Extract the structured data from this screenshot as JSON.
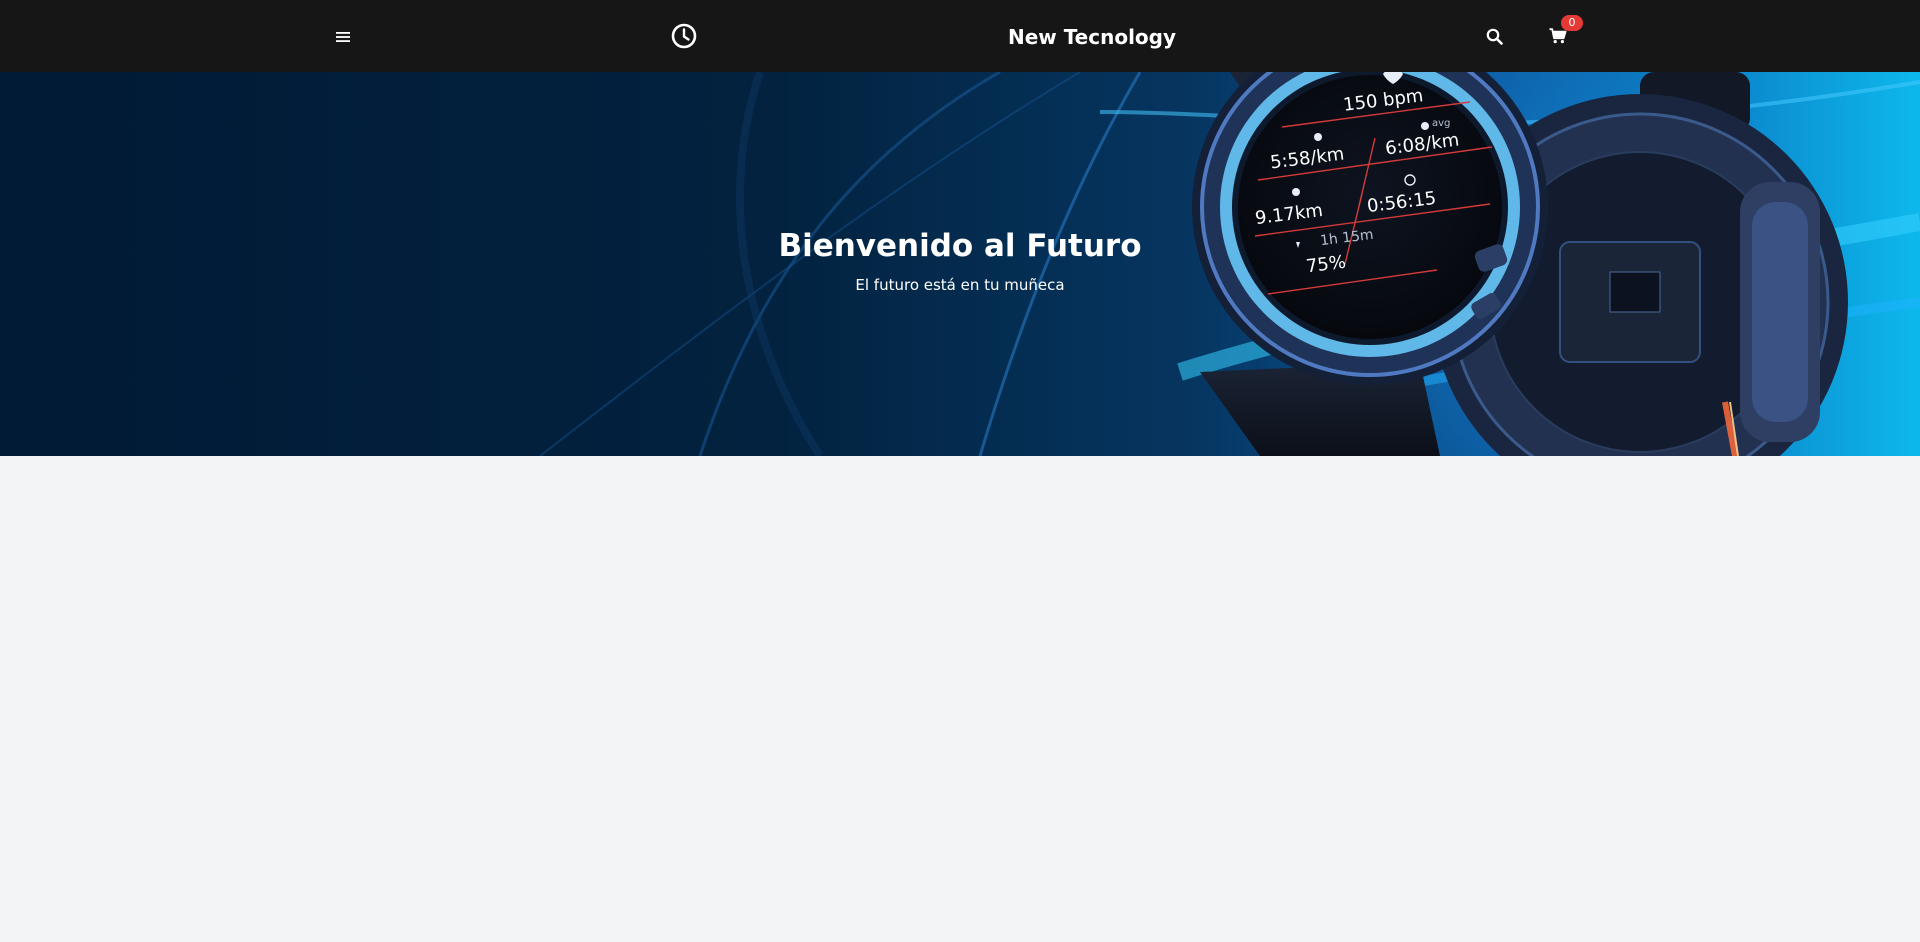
{
  "navbar": {
    "brand": "New Tecnology",
    "menu_icon": "hamburger-menu-icon",
    "history_icon": "clock-icon",
    "search_icon": "search-icon",
    "cart_icon": "shopping-cart-icon",
    "cart_count": "0",
    "background": "#161616",
    "badge_color": "#e53935"
  },
  "hero": {
    "title": "Bienvenido al Futuro",
    "subtitle": "El futuro está en tu muñeca",
    "image": "smartwatch-banner-image",
    "watch_face": {
      "heart_rate": "150 bpm",
      "pace": "5:58/km",
      "avg_label": "avg",
      "avg_pace": "6:08/km",
      "distance": "9.17km",
      "time": "0:56:15",
      "duration": "1h 15m",
      "percent": "75%"
    }
  }
}
